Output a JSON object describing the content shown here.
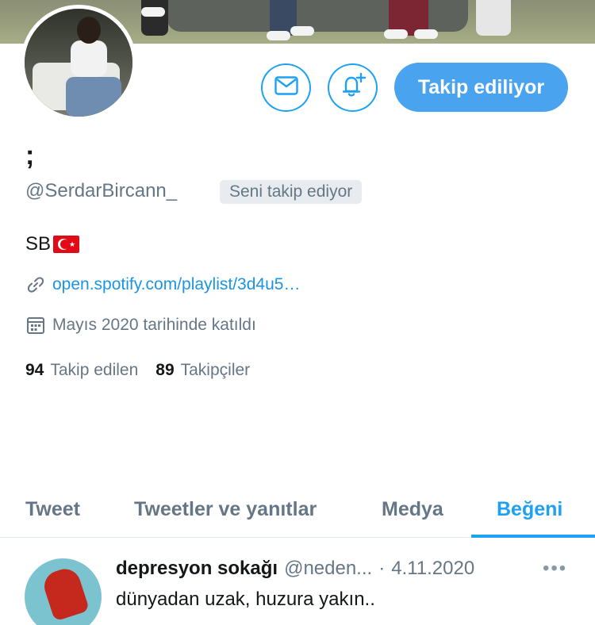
{
  "profile": {
    "display_name": ";",
    "handle": "@SerdarBircann_",
    "follows_you_badge": "Seni takip ediyor",
    "bio": "SB",
    "link": "open.spotify.com/playlist/3d4u5…",
    "joined": "Mayıs 2020 tarihinde katıldı",
    "following_count": "94",
    "following_label": "Takip edilen",
    "followers_count": "89",
    "followers_label": "Takipçiler"
  },
  "actions": {
    "message_icon": "envelope-icon",
    "notify_icon": "bell-plus-icon",
    "follow_label": "Takip ediliyor"
  },
  "tabs": [
    {
      "label": "Tweet",
      "active": false
    },
    {
      "label": "Tweetler ve yanıtlar",
      "active": false
    },
    {
      "label": "Medya",
      "active": false
    },
    {
      "label": "Beğeni",
      "active": true
    }
  ],
  "tweet": {
    "name": "depresyon sokağı",
    "handle": "@neden...",
    "separator": "·",
    "date": "4.11.2020",
    "more": "•••",
    "text": "dünyadan uzak, huzura yakın.."
  },
  "colors": {
    "accent": "#1da1f2",
    "follow_button": "#4aa3ee",
    "secondary_text": "#657786"
  }
}
